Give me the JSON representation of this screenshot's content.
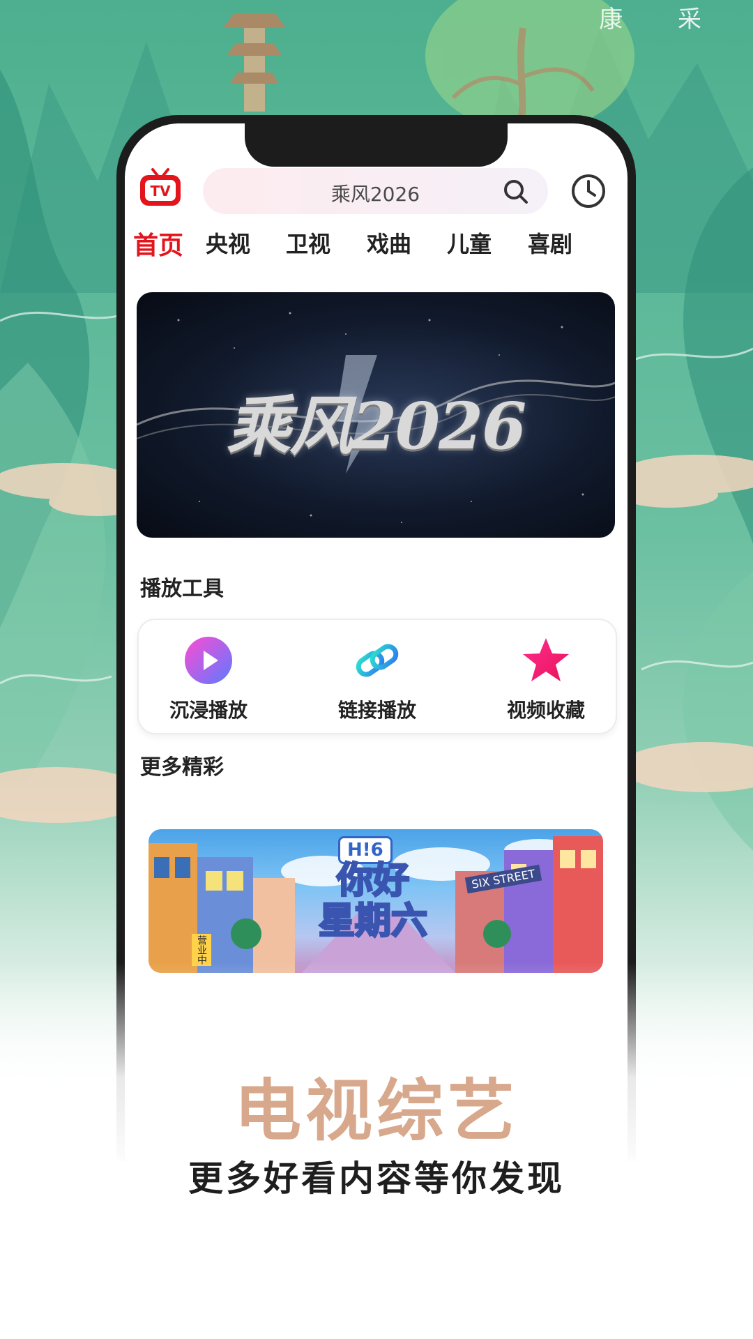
{
  "background": {
    "corner_text": "康 采"
  },
  "header": {
    "logo_text": "TV",
    "search_value": "乘风2026"
  },
  "tabs": [
    {
      "label": "首页",
      "active": true
    },
    {
      "label": "央视",
      "active": false
    },
    {
      "label": "卫视",
      "active": false
    },
    {
      "label": "戏曲",
      "active": false
    },
    {
      "label": "儿童",
      "active": false
    },
    {
      "label": "喜剧",
      "active": false
    }
  ],
  "banner": {
    "title": "乘风2026"
  },
  "tools_section": {
    "title": "播放工具",
    "items": [
      {
        "label": "沉浸播放",
        "icon": "play-icon"
      },
      {
        "label": "链接播放",
        "icon": "link-icon"
      },
      {
        "label": "视频收藏",
        "icon": "star-icon"
      }
    ]
  },
  "more_section": {
    "title": "更多精彩",
    "promo": {
      "logo": "H!6",
      "title_line1": "你好",
      "title_line2": "星期六",
      "street_sign": "SIX STREET",
      "shop_sign": "营业中"
    }
  },
  "captions": {
    "main": "电视综艺",
    "sub": "更多好看内容等你发现"
  },
  "colors": {
    "accent": "#e3141c",
    "caption_main": "#d8a88c"
  }
}
